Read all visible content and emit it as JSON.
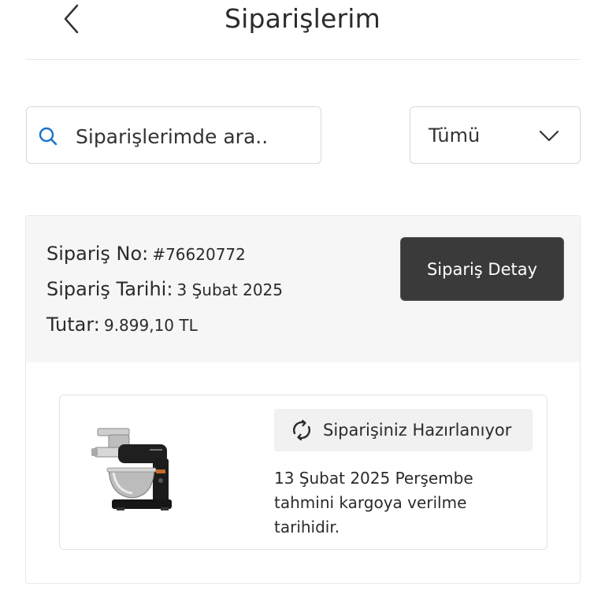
{
  "header": {
    "title": "Siparişlerim",
    "back_icon": "chevron-left-icon"
  },
  "search": {
    "placeholder": "Siparişlerimde ara..",
    "icon": "search-icon",
    "icon_color": "#1a73c9"
  },
  "filter": {
    "selected": "Tümü",
    "icon": "chevron-down-icon"
  },
  "order": {
    "number_label": "Sipariş No:",
    "number_value": "#76620772",
    "date_label": "Sipariş Tarihi:",
    "date_value": "3 Şubat 2025",
    "total_label": "Tutar:",
    "total_value": "9.899,10 TL",
    "detail_button_label": "Sipariş Detay",
    "detail_button_color": "#3a3a3a",
    "item": {
      "image": "stand-mixer-image",
      "status_icon": "refresh-icon",
      "status_text": "Siparişiniz Hazırlanıyor",
      "delivery_note": "13 Şubat 2025 Perşembe tahmini kargoya verilme tarihidir."
    }
  }
}
